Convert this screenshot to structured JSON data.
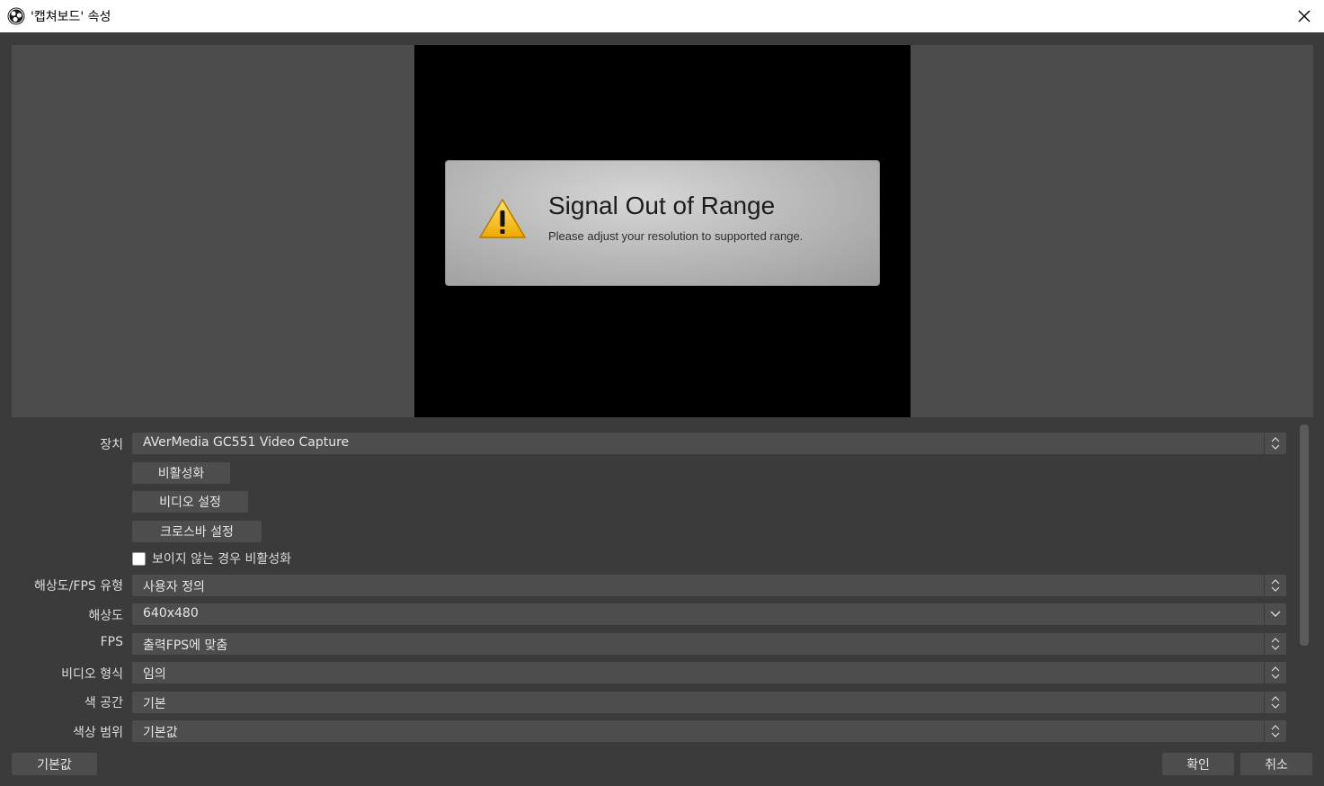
{
  "window": {
    "title": "'캡쳐보드' 속성"
  },
  "icons": {
    "app": "obs-logo-icon",
    "close": "close-icon",
    "warning": "warning-triangle-icon",
    "updown": "up-down-chevron-icon",
    "dropdown": "chevron-down-icon"
  },
  "preview": {
    "signal_title": "Signal Out of Range",
    "signal_subtitle": "Please adjust your resolution to supported range."
  },
  "settings": {
    "device": {
      "label": "장치",
      "value": "AVerMedia GC551 Video Capture"
    },
    "buttons": {
      "deactivate": "비활성화",
      "video_settings": "비디오 설정",
      "crossbar_settings": "크로스바 설정"
    },
    "checkbox": {
      "label": "보이지 않는 경우 비활성화",
      "checked": false
    },
    "res_fps_type": {
      "label": "해상도/FPS 유형",
      "value": "사용자 정의"
    },
    "resolution": {
      "label": "해상도",
      "value": "640x480"
    },
    "fps": {
      "label": "FPS",
      "value": "출력FPS에 맞춤"
    },
    "video_format": {
      "label": "비디오 형식",
      "value": "임의"
    },
    "color_space": {
      "label": "색 공간",
      "value": "기본"
    },
    "color_range": {
      "label": "색상 범위",
      "value": "기본값"
    }
  },
  "footer": {
    "defaults": "기본값",
    "ok": "확인",
    "cancel": "취소"
  },
  "colors": {
    "background": "#3b3b3b",
    "preview_bg": "#4c4c4c",
    "control_bg": "#4d4d4d",
    "title_bar": "#ffffff"
  }
}
